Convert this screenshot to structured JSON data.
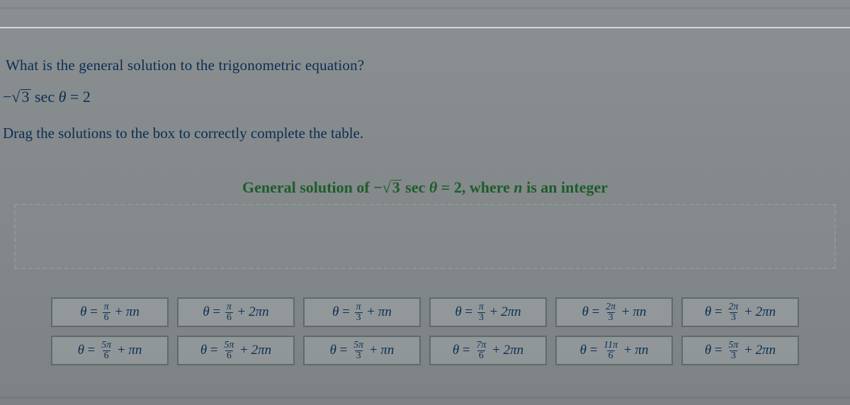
{
  "question": "What is the general solution to the trigonometric equation?",
  "equation": {
    "prefix": "−",
    "radicand": "3",
    "func": "sec",
    "var": "θ",
    "rhs": "2"
  },
  "instruction": "Drag the solutions to the box to correctly complete the table.",
  "table_title": {
    "lead": "General solution of ",
    "prefix": "−",
    "radicand": "3",
    "func": "sec",
    "var": "θ",
    "rhs": "2",
    "tail": ", where ",
    "nvar": "n",
    "tail2": " is an integer"
  },
  "tiles": {
    "row1": [
      {
        "num": "π",
        "den": "6",
        "period": "πn"
      },
      {
        "num": "π",
        "den": "6",
        "period": "2πn"
      },
      {
        "num": "π",
        "den": "3",
        "period": "πn"
      },
      {
        "num": "π",
        "den": "3",
        "period": "2πn"
      },
      {
        "num": "2π",
        "den": "3",
        "period": "πn"
      },
      {
        "num": "2π",
        "den": "3",
        "period": "2πn"
      }
    ],
    "row2": [
      {
        "num": "5π",
        "den": "6",
        "period": "πn"
      },
      {
        "num": "5π",
        "den": "6",
        "period": "2πn"
      },
      {
        "num": "5π",
        "den": "3",
        "period": "πn"
      },
      {
        "num": "7π",
        "den": "6",
        "period": "2πn"
      },
      {
        "num": "11π",
        "den": "6",
        "period": "πn"
      },
      {
        "num": "5π",
        "den": "3",
        "period": "2πn"
      }
    ]
  }
}
